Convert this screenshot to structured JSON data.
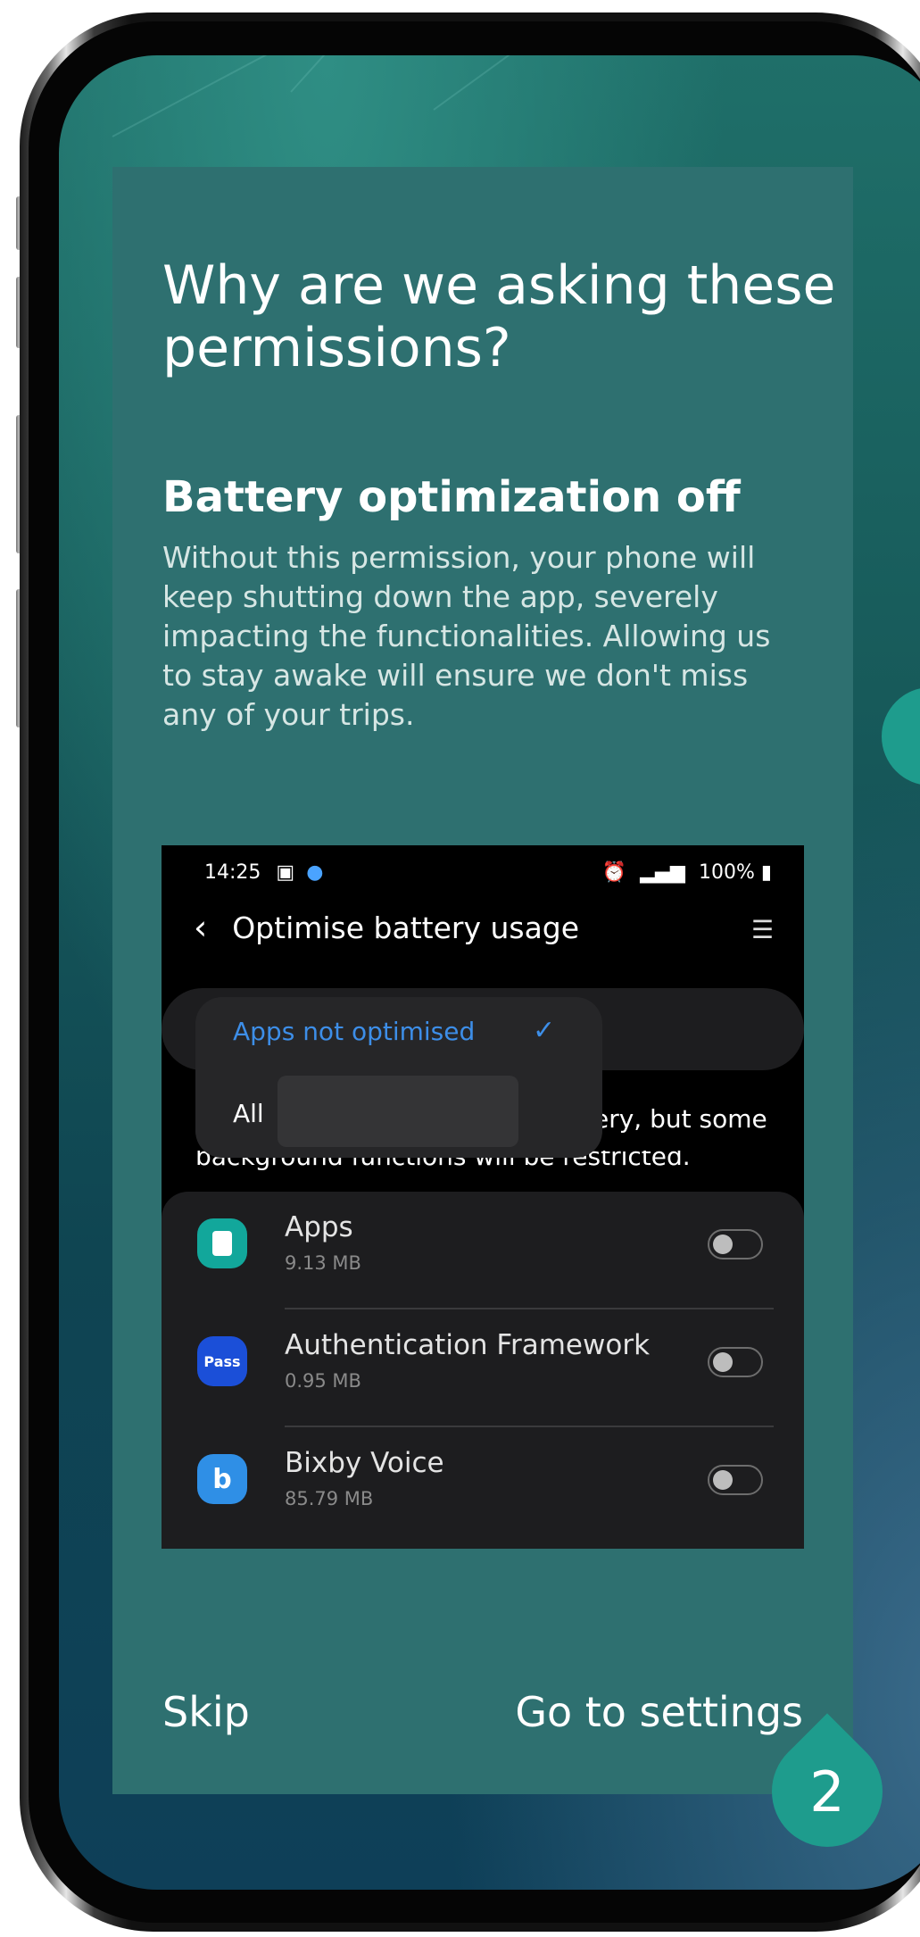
{
  "permissions_screen": {
    "title": "Why are we asking these permissions?",
    "section_title": "Battery optimization off",
    "description": "Without this permission, your phone will keep shutting down the app, severely impacting the functionalities. Allowing us to stay awake will ensure we don't miss any of your trips.",
    "skip_label": "Skip",
    "settings_label": "Go to settings",
    "step_number": "2"
  },
  "example_screenshot": {
    "status_time": "14:25",
    "status_battery": "100%",
    "header_title": "Optimise battery usage",
    "dropdown_selected": "Apps not optimised",
    "dropdown_other": "All",
    "partial_text_line1": "ery, but some",
    "partial_text_line2": "background functions will be restricted.",
    "apps": [
      {
        "name": "Apps",
        "size": "9.13 MB",
        "icon_label": "",
        "icon_color": "#12a79b"
      },
      {
        "name": "Authentication Framework",
        "size": "0.95 MB",
        "icon_label": "Pass",
        "icon_color": "#1b4fd8"
      },
      {
        "name": "Bixby Voice",
        "size": "85.79 MB",
        "icon_label": "b",
        "icon_color": "#2f8fe6"
      }
    ]
  },
  "colors": {
    "card": "#2e7070",
    "accent": "#1e9c8d",
    "dropdown_selected": "#3d8ee8"
  }
}
